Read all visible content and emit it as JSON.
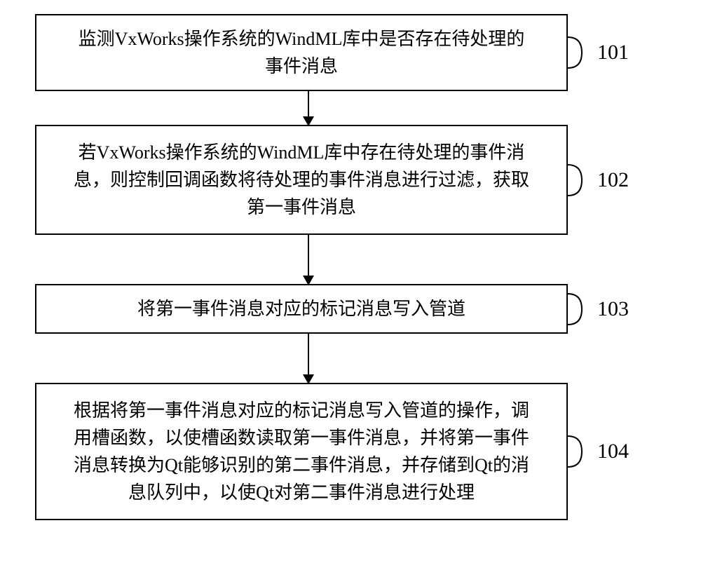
{
  "flowchart": {
    "steps": [
      {
        "text": "监测VxWorks操作系统的WindML库中是否存在待处理的\n事件消息",
        "label": "101"
      },
      {
        "text": "若VxWorks操作系统的WindML库中存在待处理的事件消\n息，则控制回调函数将待处理的事件消息进行过滤，获取\n第一事件消息",
        "label": "102"
      },
      {
        "text": "将第一事件消息对应的标记消息写入管道",
        "label": "103"
      },
      {
        "text": "根据将第一事件消息对应的标记消息写入管道的操作，调\n用槽函数，以使槽函数读取第一事件消息，并将第一事件\n消息转换为Qt能够识别的第二事件消息，并存储到Qt的消\n息队列中，以使Qt对第二事件消息进行处理",
        "label": "104"
      }
    ]
  }
}
